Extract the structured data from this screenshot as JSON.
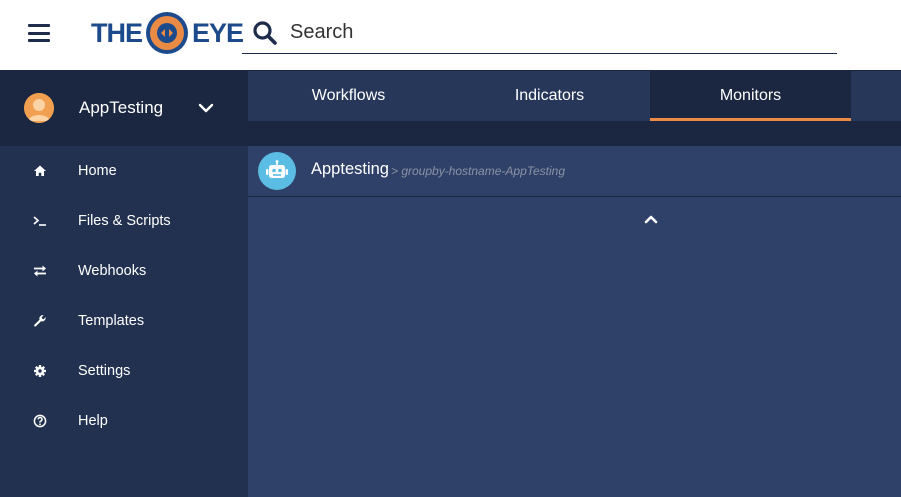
{
  "header": {
    "logo_left": "THE",
    "logo_right": "EYE",
    "search_placeholder": "Search"
  },
  "user": {
    "name": "AppTesting"
  },
  "nav": {
    "items": [
      {
        "label": "Home",
        "icon": "home-icon"
      },
      {
        "label": "Files & Scripts",
        "icon": "terminal-icon"
      },
      {
        "label": "Webhooks",
        "icon": "exchange-icon"
      },
      {
        "label": "Templates",
        "icon": "wrench-icon"
      },
      {
        "label": "Settings",
        "icon": "gear-icon"
      },
      {
        "label": "Help",
        "icon": "question-circle-icon"
      }
    ]
  },
  "tabs": [
    {
      "label": "Workflows",
      "active": false
    },
    {
      "label": "Indicators",
      "active": false
    },
    {
      "label": "Monitors",
      "active": true
    }
  ],
  "monitors": [
    {
      "name": "Apptesting",
      "subtitle": "> groupby-hostname-AppTesting",
      "icon": "robot-icon"
    }
  ],
  "colors": {
    "accent": "#e98b45",
    "sidebar": "#22314f",
    "content": "#2f4168",
    "logo_blue": "#1d4a8a",
    "robot_bg": "#5bbde3"
  }
}
